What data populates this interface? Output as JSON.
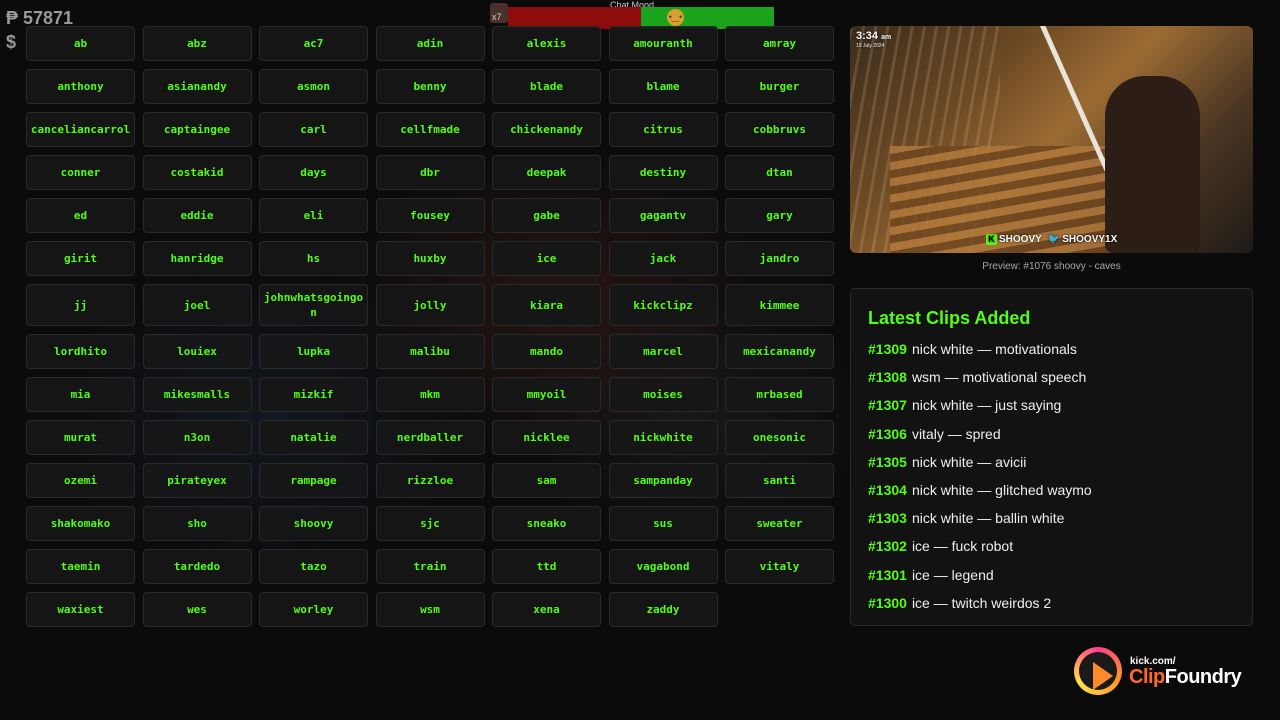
{
  "overlay": {
    "points": "₱ 57871",
    "money": "$",
    "chat_mood": {
      "label": "Chat Mood",
      "multiplier": "x7",
      "positive_fraction": 0.5,
      "negative_color": "#8e0c0c",
      "positive_color": "#1ba31b",
      "face_icon": "neutral-face-icon"
    }
  },
  "names": [
    "ab",
    "abz",
    "ac7",
    "adin",
    "alexis",
    "amouranth",
    "amray",
    "anthony",
    "asianandy",
    "asmon",
    "benny",
    "blade",
    "blame",
    "burger",
    "canceliancarrol",
    "captaingee",
    "carl",
    "cellfmade",
    "chickenandy",
    "citrus",
    "cobbruvs",
    "conner",
    "costakid",
    "days",
    "dbr",
    "deepak",
    "destiny",
    "dtan",
    "ed",
    "eddie",
    "eli",
    "fousey",
    "gabe",
    "gagantv",
    "gary",
    "girit",
    "hanridge",
    "hs",
    "huxby",
    "ice",
    "jack",
    "jandro",
    "jj",
    "joel",
    "johnwhatsgoingon",
    "jolly",
    "kiara",
    "kickclipz",
    "kimmee",
    "lordhito",
    "louiex",
    "lupka",
    "malibu",
    "mando",
    "marcel",
    "mexicanandy",
    "mia",
    "mikesmalls",
    "mizkif",
    "mkm",
    "mmyoil",
    "moises",
    "mrbased",
    "murat",
    "n3on",
    "natalie",
    "nerdballer",
    "nicklee",
    "nickwhite",
    "onesonic",
    "ozemi",
    "pirateyex",
    "rampage",
    "rizzloe",
    "sam",
    "sampanday",
    "santi",
    "shakomako",
    "sho",
    "shoovy",
    "sjc",
    "sneako",
    "sus",
    "sweater",
    "taemin",
    "tardedo",
    "tazo",
    "train",
    "ttd",
    "vagabond",
    "vitaly",
    "waxiest",
    "wes",
    "worley",
    "wsm",
    "xena",
    "zaddy"
  ],
  "preview": {
    "time": "3:34",
    "ampm": "am",
    "date": "19 July 2024",
    "tags": [
      "SHOOVY",
      "SHOOVY1X"
    ],
    "caption": "Preview: #1076 shoovy - caves"
  },
  "clips": {
    "title": "Latest Clips Added",
    "items": [
      {
        "id": "#1309",
        "text": "nick white — motivationals"
      },
      {
        "id": "#1308",
        "text": "wsm — motivational speech"
      },
      {
        "id": "#1307",
        "text": "nick white — just saying"
      },
      {
        "id": "#1306",
        "text": "vitaly — spred"
      },
      {
        "id": "#1305",
        "text": "nick white — avicii"
      },
      {
        "id": "#1304",
        "text": "nick white — glitched waymo"
      },
      {
        "id": "#1303",
        "text": "nick white — ballin white"
      },
      {
        "id": "#1302",
        "text": "ice — fuck robot"
      },
      {
        "id": "#1301",
        "text": "ice — legend"
      },
      {
        "id": "#1300",
        "text": "ice — twitch weirdos 2"
      }
    ]
  },
  "logo": {
    "kick": "kick.com/",
    "clip": "Clip",
    "foundry": "Foundry"
  },
  "colors": {
    "accent": "#53fc18",
    "background": "#0b0b0c"
  }
}
